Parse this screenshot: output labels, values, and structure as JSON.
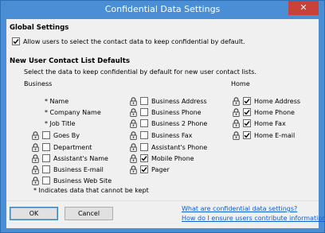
{
  "window": {
    "title": "Confidential Data Settings",
    "close_glyph": "✕"
  },
  "global": {
    "heading": "Global Settings",
    "allow_label": "Allow users to select the contact data to keep confidential by default.",
    "allow_checked": true
  },
  "defaults": {
    "heading": "New User Contact List Defaults",
    "description": "Select the data to keep confidential by default for new user contact lists.",
    "business_heading": "Business",
    "home_heading": "Home",
    "business_col1": [
      {
        "label": "* Name",
        "locked": false,
        "checkbox": false,
        "checked": false
      },
      {
        "label": "* Company Name",
        "locked": false,
        "checkbox": false,
        "checked": false
      },
      {
        "label": "* Job Title",
        "locked": false,
        "checkbox": false,
        "checked": false
      },
      {
        "label": "Goes By",
        "locked": true,
        "checkbox": true,
        "checked": false
      },
      {
        "label": "Department",
        "locked": true,
        "checkbox": true,
        "checked": false
      },
      {
        "label": "Assistant's Name",
        "locked": true,
        "checkbox": true,
        "checked": false
      },
      {
        "label": "Business E-mail",
        "locked": true,
        "checkbox": true,
        "checked": false
      },
      {
        "label": "Business Web Site",
        "locked": true,
        "checkbox": true,
        "checked": false
      }
    ],
    "business_col2": [
      {
        "label": "Business Address",
        "locked": true,
        "checked": false
      },
      {
        "label": "Business Phone",
        "locked": true,
        "checked": false
      },
      {
        "label": "Business 2 Phone",
        "locked": true,
        "checked": false
      },
      {
        "label": "Business Fax",
        "locked": true,
        "checked": false
      },
      {
        "label": "Assistant's Phone",
        "locked": true,
        "checked": false
      },
      {
        "label": "Mobile Phone",
        "locked": true,
        "checked": true
      },
      {
        "label": "Pager",
        "locked": true,
        "checked": true
      }
    ],
    "home_col": [
      {
        "label": "Home Address",
        "locked": true,
        "checked": true
      },
      {
        "label": "Home Phone",
        "locked": true,
        "checked": true
      },
      {
        "label": "Home Fax",
        "locked": true,
        "checked": true
      },
      {
        "label": "Home E-mail",
        "locked": true,
        "checked": true
      }
    ],
    "footnote": "* Indicates data that cannot be kept"
  },
  "buttons": {
    "ok": "OK",
    "cancel": "Cancel"
  },
  "links": {
    "what": "What are confidential data settings?",
    "how": "How do I ensure users contribute information?"
  }
}
